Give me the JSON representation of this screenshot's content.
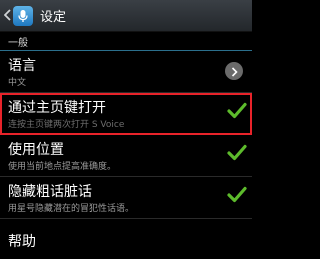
{
  "action_bar": {
    "title": "设定",
    "back_icon": "chevron-left-icon",
    "app_icon": "s-voice-mic-icon"
  },
  "section": {
    "general": "一般"
  },
  "settings": [
    {
      "label": "语言",
      "summary": "中文",
      "control": "chevron-right-icon"
    },
    {
      "label": "通过主页键打开",
      "summary": "连按主页键两次打开 S Voice",
      "control": "checkbox",
      "checked": true,
      "highlighted": true
    },
    {
      "label": "使用位置",
      "summary": "使用当前地点提高准确度。",
      "control": "checkbox",
      "checked": true
    },
    {
      "label": "隐藏粗话脏话",
      "summary": "用星号隐藏潜在的冒犯性话语。",
      "control": "checkbox",
      "checked": true
    },
    {
      "label": "帮助"
    }
  ],
  "colors": {
    "check_green": "#5dbb2c",
    "highlight_red": "#e8232a",
    "divider_blue": "#2b6f8c"
  }
}
